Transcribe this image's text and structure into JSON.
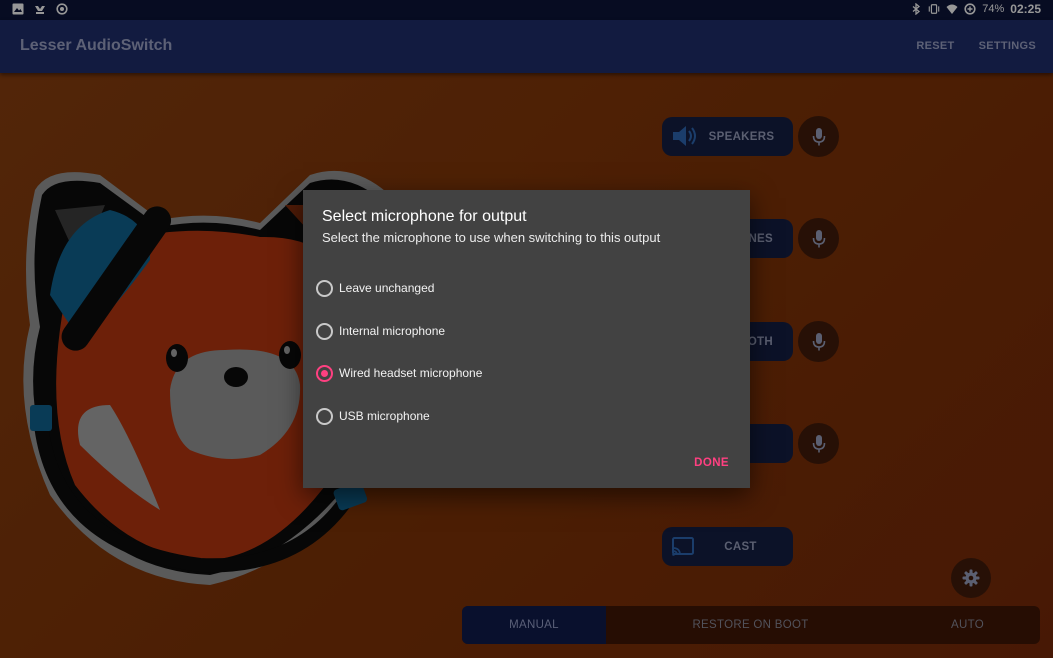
{
  "status_bar": {
    "left_icons": [
      "image-icon",
      "drive-icon",
      "circle-target-icon"
    ],
    "right_icons": [
      "bluetooth-icon",
      "vibrate-icon",
      "wifi-icon",
      "data-saver-icon",
      "battery-icon"
    ],
    "battery": "74%",
    "time": "02:25"
  },
  "app_bar": {
    "title": "Lesser AudioSwitch",
    "actions": {
      "reset": "RESET",
      "settings": "SETTINGS"
    }
  },
  "outputs": {
    "speakers": "SPEAKERS",
    "headphones_partial": "ONES",
    "bluetooth_partial": "OTH",
    "cast": "CAST"
  },
  "tabs": {
    "manual": "MANUAL",
    "restore": "RESTORE ON BOOT",
    "auto": "AUTO",
    "selected": "MANUAL"
  },
  "dialog": {
    "title": "Select microphone for output",
    "subtitle": "Select the microphone to use when switching to this output",
    "options": [
      "Leave unchanged",
      "Internal microphone",
      "Wired headset microphone",
      "USB microphone"
    ],
    "selected": "Wired headset microphone",
    "done_label": "DONE"
  },
  "colors": {
    "accent": "#ff4081",
    "app_bar": "#1d2a63",
    "status_bar": "#0b1335",
    "background": "#7a360c",
    "dialog": "#424242"
  }
}
